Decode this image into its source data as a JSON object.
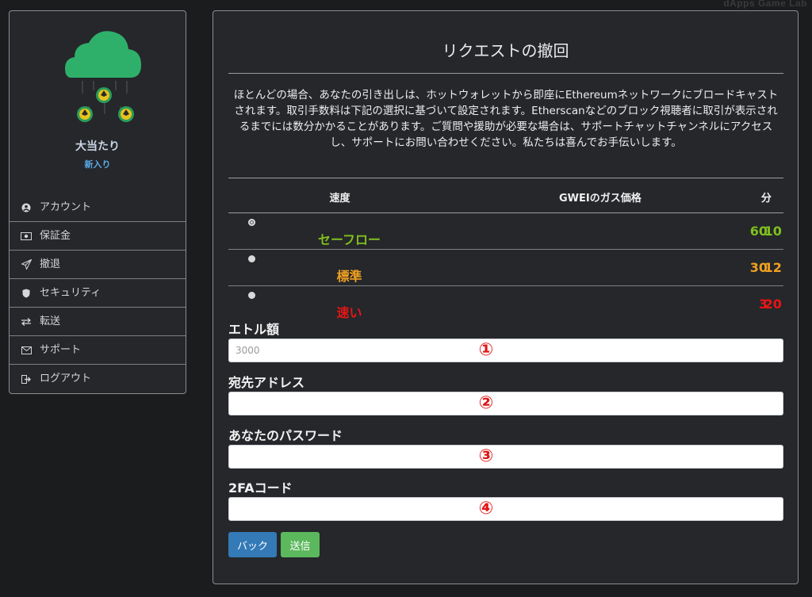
{
  "watermark": "dApps Game Lab",
  "profile": {
    "name": "大当たり",
    "rank": "新入り"
  },
  "nav": [
    {
      "label": "アカウント",
      "icon": "user-circle-icon"
    },
    {
      "label": "保証金",
      "icon": "money-bill-icon"
    },
    {
      "label": "撤退",
      "icon": "paper-plane-icon"
    },
    {
      "label": "セキュリティ",
      "icon": "shield-icon"
    },
    {
      "label": "転送",
      "icon": "exchange-icon"
    },
    {
      "label": "サポート",
      "icon": "envelope-icon"
    },
    {
      "label": "ログアウト",
      "icon": "sign-out-icon"
    }
  ],
  "panel": {
    "title": "リクエストの撤回",
    "description": "ほとんどの場合、あなたの引き出しは、ホットウォレットから即座にEthereumネットワークにブロードキャストされます。取引手数料は下記の選択に基づいて設定されます。Etherscanなどのブロック視聴者に取引が表示されるまでには数分かかることがあります。ご質問や援助が必要な場合は、サポートチャットチャンネルにアクセスし、サポートにお問い合わせください。私たちは喜んでお手伝いします。"
  },
  "speed_table": {
    "headers": {
      "speed": "速度",
      "gas": "GWEIのガス価格",
      "minutes": "分"
    },
    "rows": [
      {
        "label": "セーフロー",
        "gas": "10",
        "minutes": "60",
        "color": "#7fbf1f",
        "selected": true
      },
      {
        "label": "標準",
        "gas": "12",
        "minutes": "30",
        "color": "#f0a020",
        "selected": false
      },
      {
        "label": "速い",
        "gas": "20",
        "minutes": "3",
        "color": "#e81515",
        "selected": false
      }
    ]
  },
  "form": {
    "amount_label": "エトル額",
    "amount_placeholder": "3000",
    "address_label": "宛先アドレス",
    "password_label": "あなたのパスワード",
    "twofa_label": "2FAコード",
    "markers": [
      "①",
      "②",
      "③",
      "④"
    ]
  },
  "buttons": {
    "back": "バック",
    "send": "送信"
  },
  "colors": {
    "cloud": "#2fb06a",
    "coin": "#2a9d5a",
    "accent_blue": "#337ab7",
    "accent_green": "#5cb85c"
  }
}
